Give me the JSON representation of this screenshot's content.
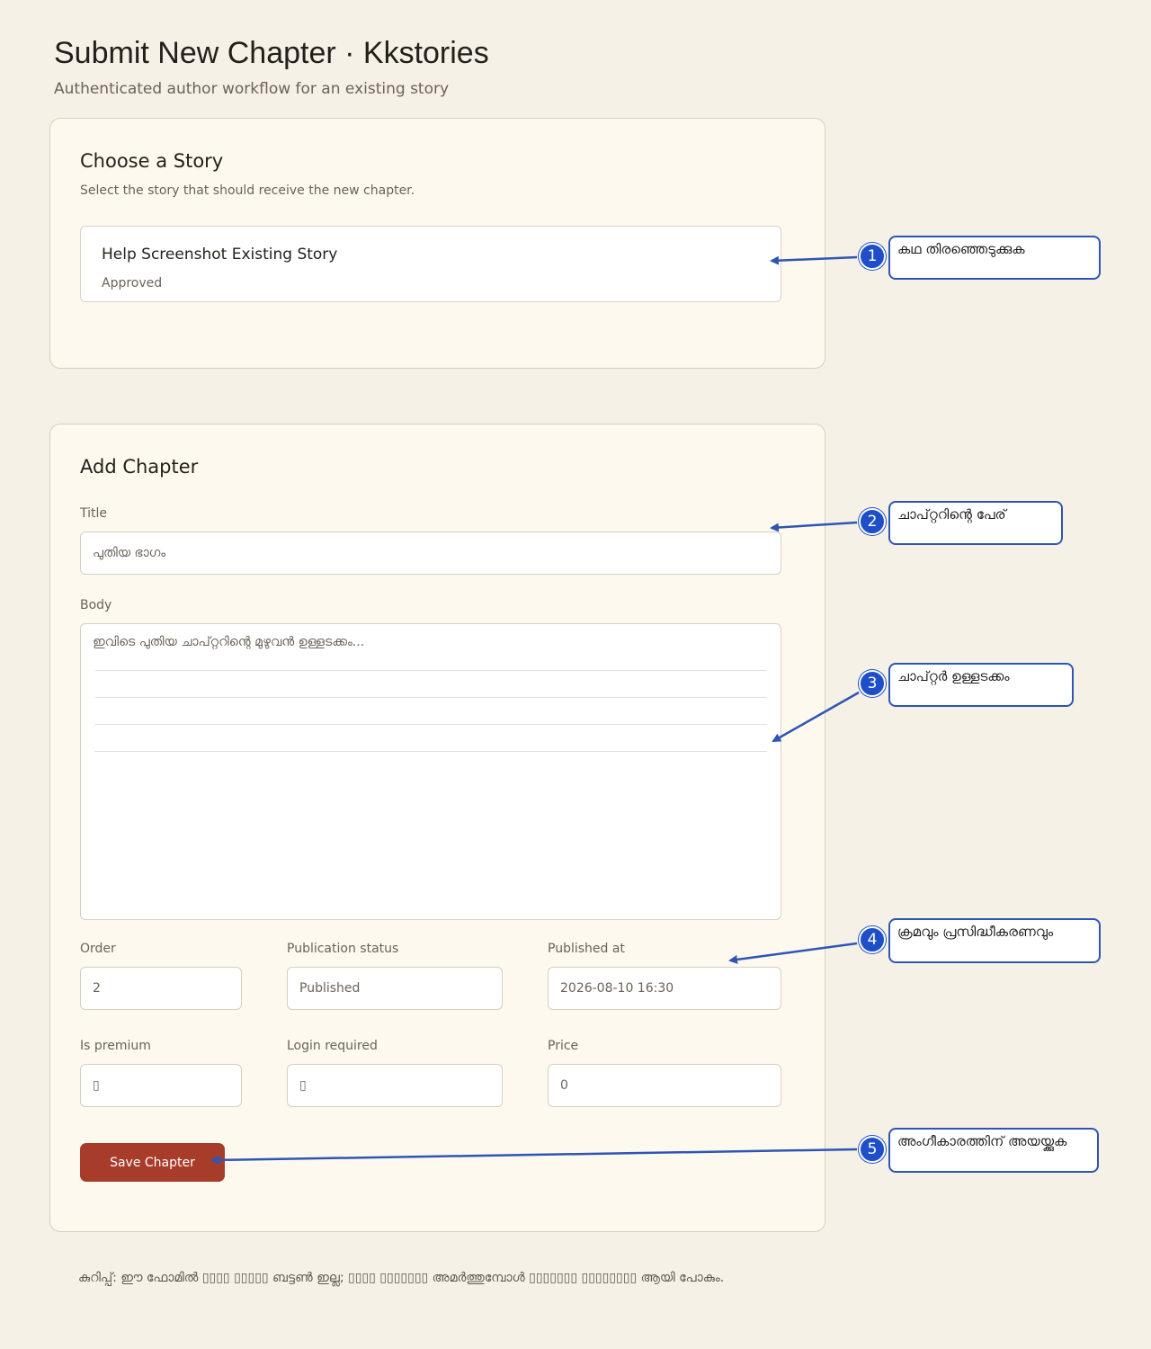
{
  "page": {
    "title": "Submit New Chapter · Kkstories",
    "subtitle": "Authenticated author workflow for an existing story"
  },
  "story_card": {
    "heading": "Choose a Story",
    "description": "Select the story that should receive the new chapter.",
    "story": {
      "name": "Help Screenshot Existing Story",
      "status": "Approved"
    }
  },
  "chapter_card": {
    "heading": "Add Chapter",
    "title_label": "Title",
    "title_placeholder": "പുതിയ ഭാഗം",
    "body_label": "Body",
    "body_placeholder": "ഇവിടെ പുതിയ ചാപ്റ്ററിന്റെ മുഴുവൻ ഉള്ളടക്കം...",
    "order_label": "Order",
    "order_value": "2",
    "publication_status_label": "Publication status",
    "publication_status_value": "Published",
    "published_at_label": "Published at",
    "published_at_value": "2026-08-10 16:30",
    "is_premium_label": "Is premium",
    "is_premium_value": "▯",
    "login_required_label": "Login required",
    "login_required_value": "▯",
    "price_label": "Price",
    "price_value": "0",
    "save_button": "Save Chapter"
  },
  "footer_note": "കുറിപ്പ്: ഈ ഫോമിൽ ▯▯▯▯ ▯▯▯▯▯ ബട്ടൺ ഇല്ല; ▯▯▯▯ ▯▯▯▯▯▯▯ അമർത്തുമ്പോൾ ▯▯▯▯▯▯▯ ▯▯▯▯▯▯▯▯ ആയി പോകും.",
  "callouts": [
    {
      "number": "1",
      "text": "കഥ തിരഞ്ഞെടുക്കുക"
    },
    {
      "number": "2",
      "text": "ചാപ്റ്ററിന്റെ പേര്"
    },
    {
      "number": "3",
      "text": "ചാപ്റ്റർ ഉള്ളടക്കം"
    },
    {
      "number": "4",
      "text": "ക്രമവും പ്രസിദ്ധീകരണവും"
    },
    {
      "number": "5",
      "text": "അംഗീകാരത്തിന് അയയ്ക്കുക"
    }
  ],
  "colors": {
    "background": "#f6f1e7",
    "card": "#fdf9ef",
    "accent_button": "#a83c2b",
    "callout_blue": "#1f4fc8"
  }
}
